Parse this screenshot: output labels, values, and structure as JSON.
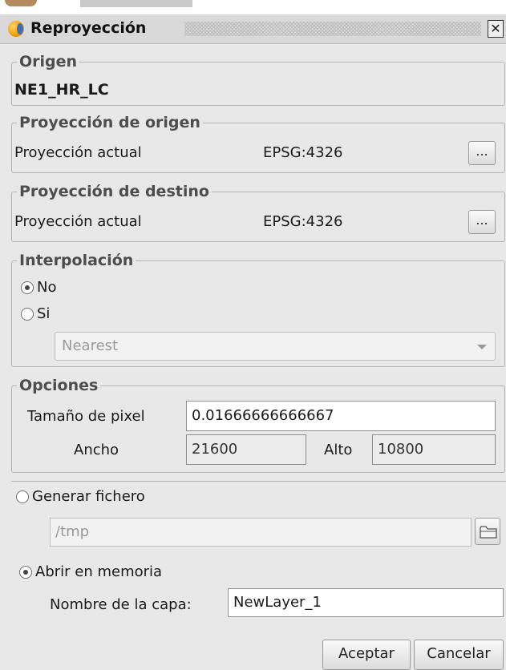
{
  "window": {
    "title": "Reproyección",
    "close_glyph": "✕"
  },
  "origen": {
    "legend": "Origen",
    "layer": "NE1_HR_LC"
  },
  "proyeccion_origen": {
    "legend": "Proyección de origen",
    "label": "Proyección actual",
    "value": "EPSG:4326",
    "button": "..."
  },
  "proyeccion_destino": {
    "legend": "Proyección de destino",
    "label": "Proyección actual",
    "value": "EPSG:4326",
    "button": "..."
  },
  "interpolacion": {
    "legend": "Interpolación",
    "option_no": "No",
    "option_si": "Si",
    "selected": "No",
    "method": "Nearest"
  },
  "opciones": {
    "legend": "Opciones",
    "pixel_label": "Tamaño de pixel",
    "pixel_value": "0.01666666666667",
    "ancho_label": "Ancho",
    "ancho_value": "21600",
    "alto_label": "Alto",
    "alto_value": "10800"
  },
  "salida": {
    "generar_label": "Generar fichero",
    "path_value": "/tmp",
    "memoria_label": "Abrir en memoria",
    "selected": "Abrir en memoria",
    "layer_name_label": "Nombre de la capa:",
    "layer_name_value": "NewLayer_1"
  },
  "buttons": {
    "accept": "Aceptar",
    "cancel": "Cancelar"
  }
}
